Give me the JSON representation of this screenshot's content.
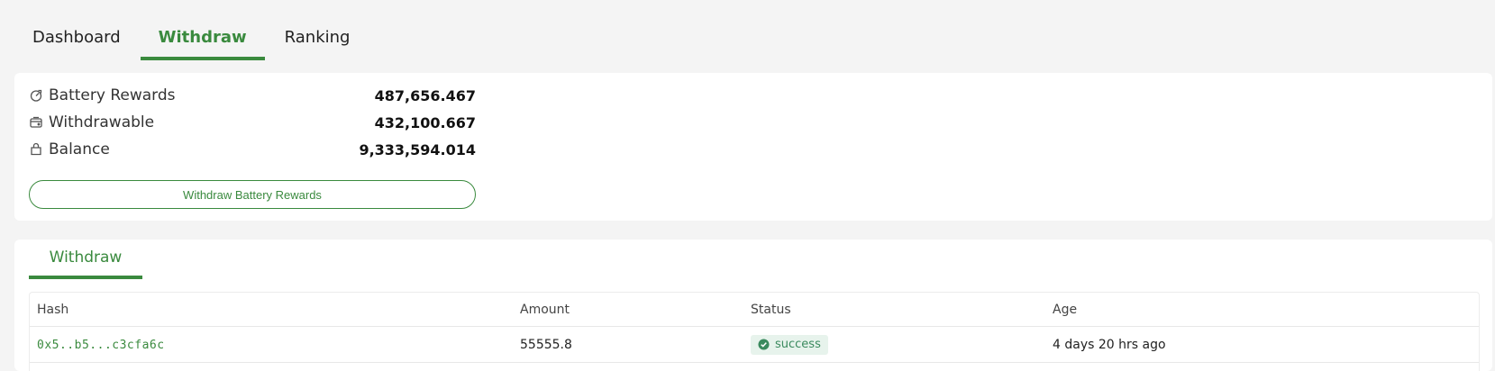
{
  "tabs": [
    {
      "label": "Dashboard",
      "active": false
    },
    {
      "label": "Withdraw",
      "active": true
    },
    {
      "label": "Ranking",
      "active": false
    }
  ],
  "summary": {
    "stats": [
      {
        "icon": "battery-reward-icon",
        "label": "Battery Rewards",
        "value": "487,656.467"
      },
      {
        "icon": "withdrawable-wallet-icon",
        "label": "Withdrawable",
        "value": "432,100.667"
      },
      {
        "icon": "balance-bag-icon",
        "label": "Balance",
        "value": "9,333,594.014"
      }
    ],
    "withdraw_button_label": "Withdraw Battery Rewards"
  },
  "history": {
    "tab_label": "Withdraw",
    "columns": [
      "Hash",
      "Amount",
      "Status",
      "Age"
    ],
    "rows": [
      {
        "hash": "0x5..b5...c3cfa6c",
        "amount": "55555.8",
        "status": "success",
        "age": "4 days 20 hrs ago"
      }
    ]
  },
  "colors": {
    "accent": "#3a8a3e",
    "success_bg": "#e7f3ec",
    "page_bg": "#f4f4f4"
  }
}
